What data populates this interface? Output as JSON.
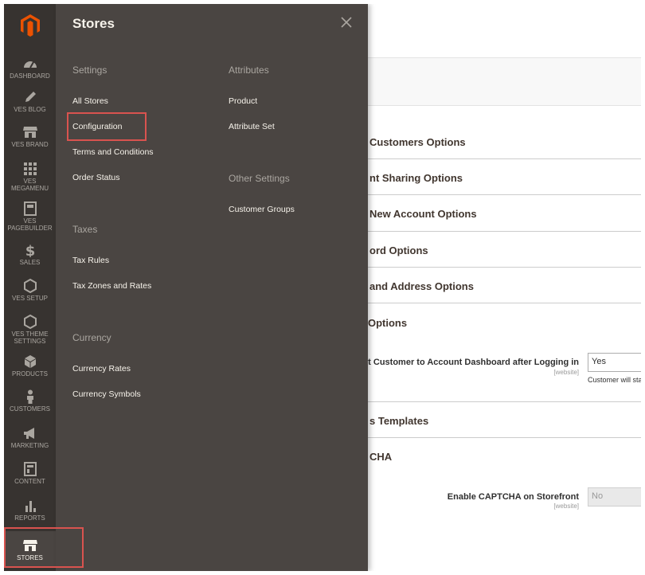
{
  "nav": {
    "items": [
      {
        "label": "Dashboard",
        "icon": "dashboard-icon"
      },
      {
        "label": "Ves Blog",
        "icon": "pencil-icon"
      },
      {
        "label": "Ves Brand",
        "icon": "storefront-icon"
      },
      {
        "label": "Ves Megamenu",
        "icon": "grid-icon"
      },
      {
        "label": "Ves Pagebuilder",
        "icon": "layout-icon"
      },
      {
        "label": "Sales",
        "icon": "dollar-icon"
      },
      {
        "label": "Ves Setup",
        "icon": "hexagon-icon"
      },
      {
        "label": "Ves Theme Settings",
        "icon": "hexagon-icon"
      },
      {
        "label": "Products",
        "icon": "box-icon"
      },
      {
        "label": "Customers",
        "icon": "person-icon"
      },
      {
        "label": "Marketing",
        "icon": "megaphone-icon"
      },
      {
        "label": "Content",
        "icon": "content-icon"
      },
      {
        "label": "Reports",
        "icon": "bar-chart-icon"
      },
      {
        "label": "Stores",
        "icon": "storefront-icon",
        "active": true
      }
    ]
  },
  "panel": {
    "title": "Stores",
    "settings": {
      "title": "Settings",
      "items": [
        "All Stores",
        "Configuration",
        "Terms and Conditions",
        "Order Status"
      ]
    },
    "taxes": {
      "title": "Taxes",
      "items": [
        "Tax Rules",
        "Tax Zones and Rates"
      ]
    },
    "currency": {
      "title": "Currency",
      "items": [
        "Currency Rates",
        "Currency Symbols"
      ]
    },
    "attributes": {
      "title": "Attributes",
      "items": [
        "Product",
        "Attribute Set"
      ]
    },
    "other": {
      "title": "Other Settings",
      "items": [
        "Customer Groups"
      ]
    }
  },
  "main": {
    "sections": [
      "Customers Options",
      "nt Sharing Options",
      "New Account Options",
      "ord Options",
      "and Address Options",
      "Options",
      "s Templates",
      "CHA"
    ],
    "redirect_field": {
      "label": "rect Customer to Account Dashboard after Logging in",
      "scope": "[website]",
      "value": "Yes",
      "note": "Customer will stay"
    },
    "captcha_field": {
      "label": "Enable CAPTCHA on Storefront",
      "scope": "[website]",
      "value": "No"
    }
  },
  "colors": {
    "nav_bg": "#373330",
    "panel_bg": "#4a4542",
    "brand": "#eb5202",
    "highlight": "#d9534f"
  }
}
